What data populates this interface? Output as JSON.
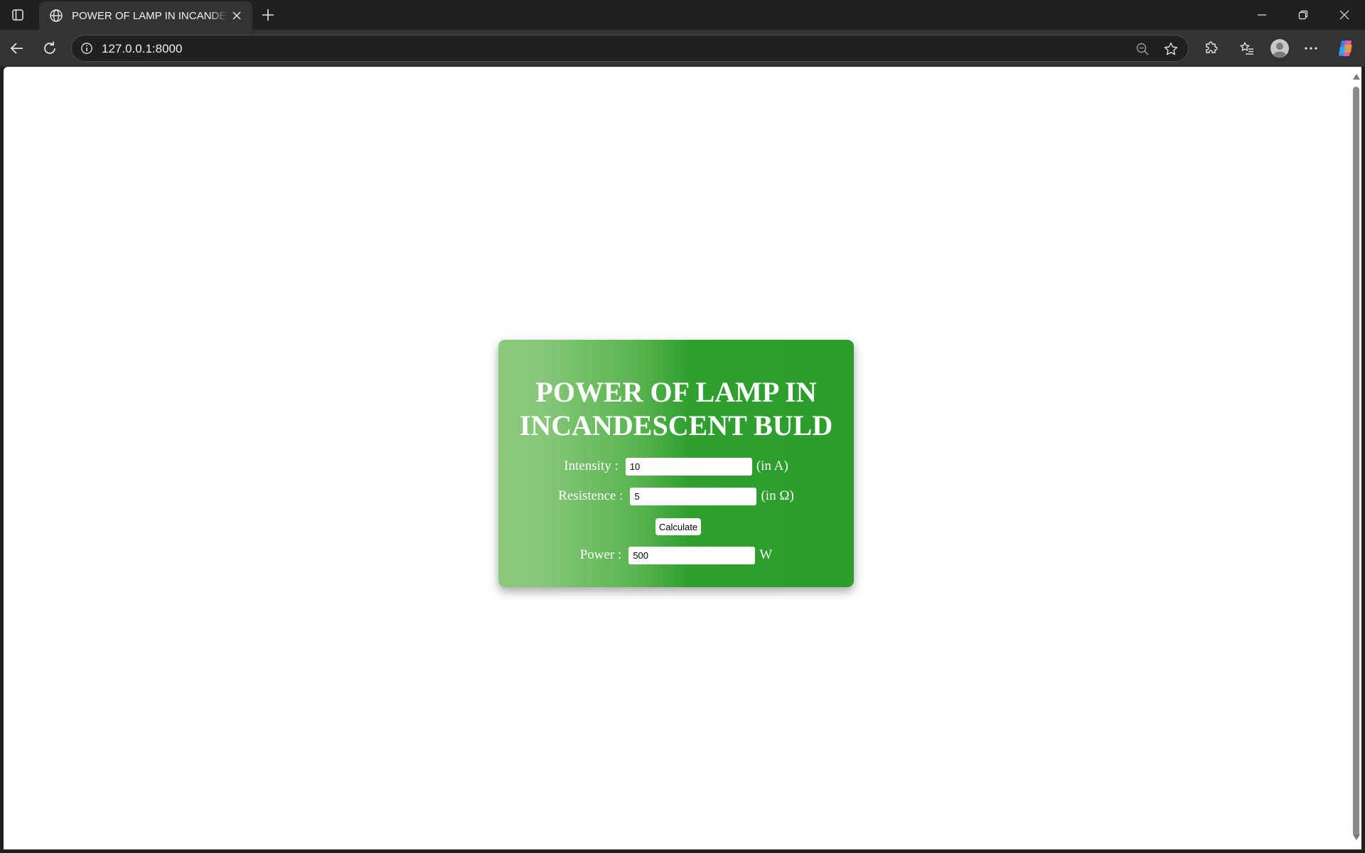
{
  "browser": {
    "tab_title": "POWER OF LAMP IN INCANDESCENT BULD",
    "url": "127.0.0.1:8000"
  },
  "page": {
    "heading_line1": "POWER OF LAMP IN",
    "heading_line2": "INCANDESCENT BULD",
    "intensity": {
      "label": "Intensity :",
      "value": "10",
      "unit": "(in A)"
    },
    "resistance": {
      "label": "Resistence :",
      "value": "5",
      "unit": "(in Ω)"
    },
    "calculate_label": "Calculate",
    "power": {
      "label": "Power :",
      "value": "500",
      "unit": "W"
    }
  },
  "colors": {
    "card_gradient_light": "#8cc97d",
    "card_gradient_dark": "#2c9e2c"
  }
}
